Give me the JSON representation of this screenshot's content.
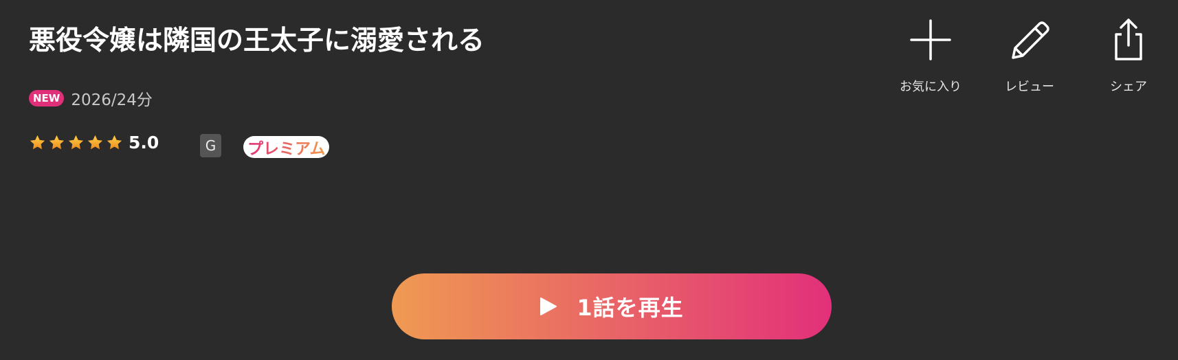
{
  "title": "悪役令嬢は隣国の王太子に溺愛される",
  "meta": {
    "badge": "NEW",
    "year_duration": "2026/24分"
  },
  "rating": {
    "stars": 5,
    "value": "5.0"
  },
  "grade": "G",
  "premium_label": "プレミアム",
  "actions": {
    "favorite": "お気に入り",
    "review": "レビュー",
    "share": "シェア"
  },
  "play_button": {
    "label": "1話を再生"
  },
  "colors": {
    "background": "#2b2b2b",
    "accent_pink": "#e2307a",
    "accent_orange": "#ef9a52",
    "grade_badge": "#555555",
    "star": "#f5a623"
  },
  "icons": {
    "favorite": "plus-icon",
    "review": "pencil-icon",
    "share": "share-icon",
    "play": "play-icon",
    "star": "star-icon"
  }
}
